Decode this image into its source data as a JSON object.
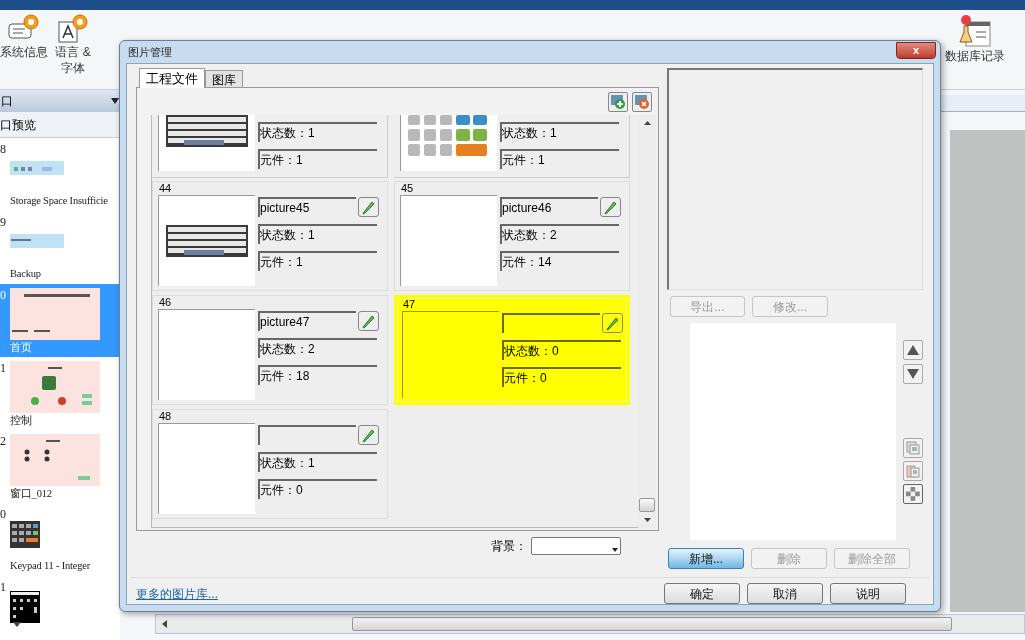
{
  "app": {
    "ribbon": [
      {
        "label": "系统信息"
      },
      {
        "label": "语言 & 字体"
      },
      {
        "label": "数据库记录"
      }
    ],
    "panel_header": "口",
    "preview_title": "口预览",
    "screens": [
      {
        "number": "8",
        "caption": "Storage Space Insufficie",
        "kind": "banner",
        "selected": false
      },
      {
        "number": "9",
        "caption": "Backup",
        "kind": "bar",
        "selected": false
      },
      {
        "number": "0",
        "caption": "首页",
        "kind": "home",
        "selected": true
      },
      {
        "number": "1",
        "caption": "控制",
        "kind": "control",
        "selected": false
      },
      {
        "number": "2",
        "caption": "窗口_012",
        "kind": "dots",
        "selected": false
      },
      {
        "number": "0",
        "caption": "Keypad 11 - Integer",
        "kind": "keypad",
        "selected": false
      },
      {
        "number": "1",
        "kind": "darkpad",
        "selected": false
      }
    ]
  },
  "dialog": {
    "title": "图片管理",
    "close": "x",
    "tabs": [
      {
        "label": "工程文件",
        "selected": true
      },
      {
        "label": "图库",
        "selected": false
      }
    ],
    "partial_cards": [
      {
        "kind": "keyboard",
        "states": "状态数：1",
        "elements": "元件：1"
      },
      {
        "kind": "keypad",
        "states": "状态数：1",
        "elements": "元件：1"
      }
    ],
    "cards": [
      {
        "number": "44",
        "name": "picture45",
        "states": "状态数：1",
        "elements": "元件：1",
        "kind": "keyboard",
        "selected": false
      },
      {
        "number": "45",
        "name": "picture46",
        "states": "状态数：2",
        "elements": "元件：14",
        "kind": "blank",
        "selected": false
      },
      {
        "number": "46",
        "name": "picture47",
        "states": "状态数：2",
        "elements": "元件：18",
        "kind": "blank",
        "selected": false
      },
      {
        "number": "47",
        "states": "状态数：0",
        "elements": "元件：0",
        "kind": "blank",
        "selected": true
      },
      {
        "number": "48",
        "states": "状态数：1",
        "elements": "元件：0",
        "kind": "blank",
        "selected": false
      }
    ],
    "export_button": {
      "label": "导出...",
      "disabled": true
    },
    "modify_button": {
      "label": "修改...",
      "disabled": true
    },
    "action_buttons": [
      {
        "label": "新增...",
        "disabled": false,
        "hover": true
      },
      {
        "label": "删除",
        "disabled": true,
        "hover": false
      },
      {
        "label": "删除全部",
        "disabled": true,
        "hover": false
      }
    ],
    "background_label": "背景：",
    "more_link": "更多的图片库...",
    "footer_buttons": [
      "确定",
      "取消",
      "说明"
    ]
  }
}
